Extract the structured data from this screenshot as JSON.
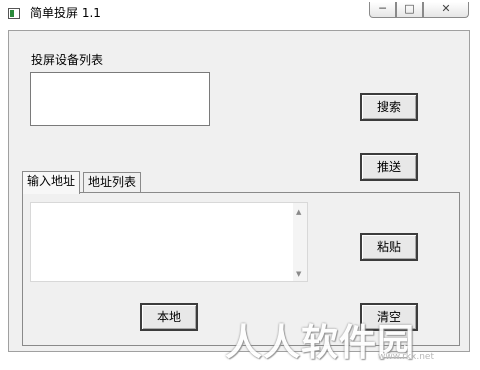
{
  "window": {
    "title": "简单投屏 1.1"
  },
  "window_buttons": {
    "minimize": "─",
    "maximize": "□",
    "close": "✕"
  },
  "device_list": {
    "label": "投屏设备列表"
  },
  "buttons": {
    "search": "搜索",
    "push": "推送",
    "paste": "粘贴",
    "clear": "清空",
    "local": "本地"
  },
  "tabs": [
    {
      "label": "输入地址"
    },
    {
      "label": "地址列表"
    }
  ],
  "address_input": {
    "value": ""
  },
  "scroll": {
    "up": "▲",
    "down": "▼"
  },
  "watermark": {
    "text": "人人软件园",
    "url": "www.rkx.net"
  }
}
